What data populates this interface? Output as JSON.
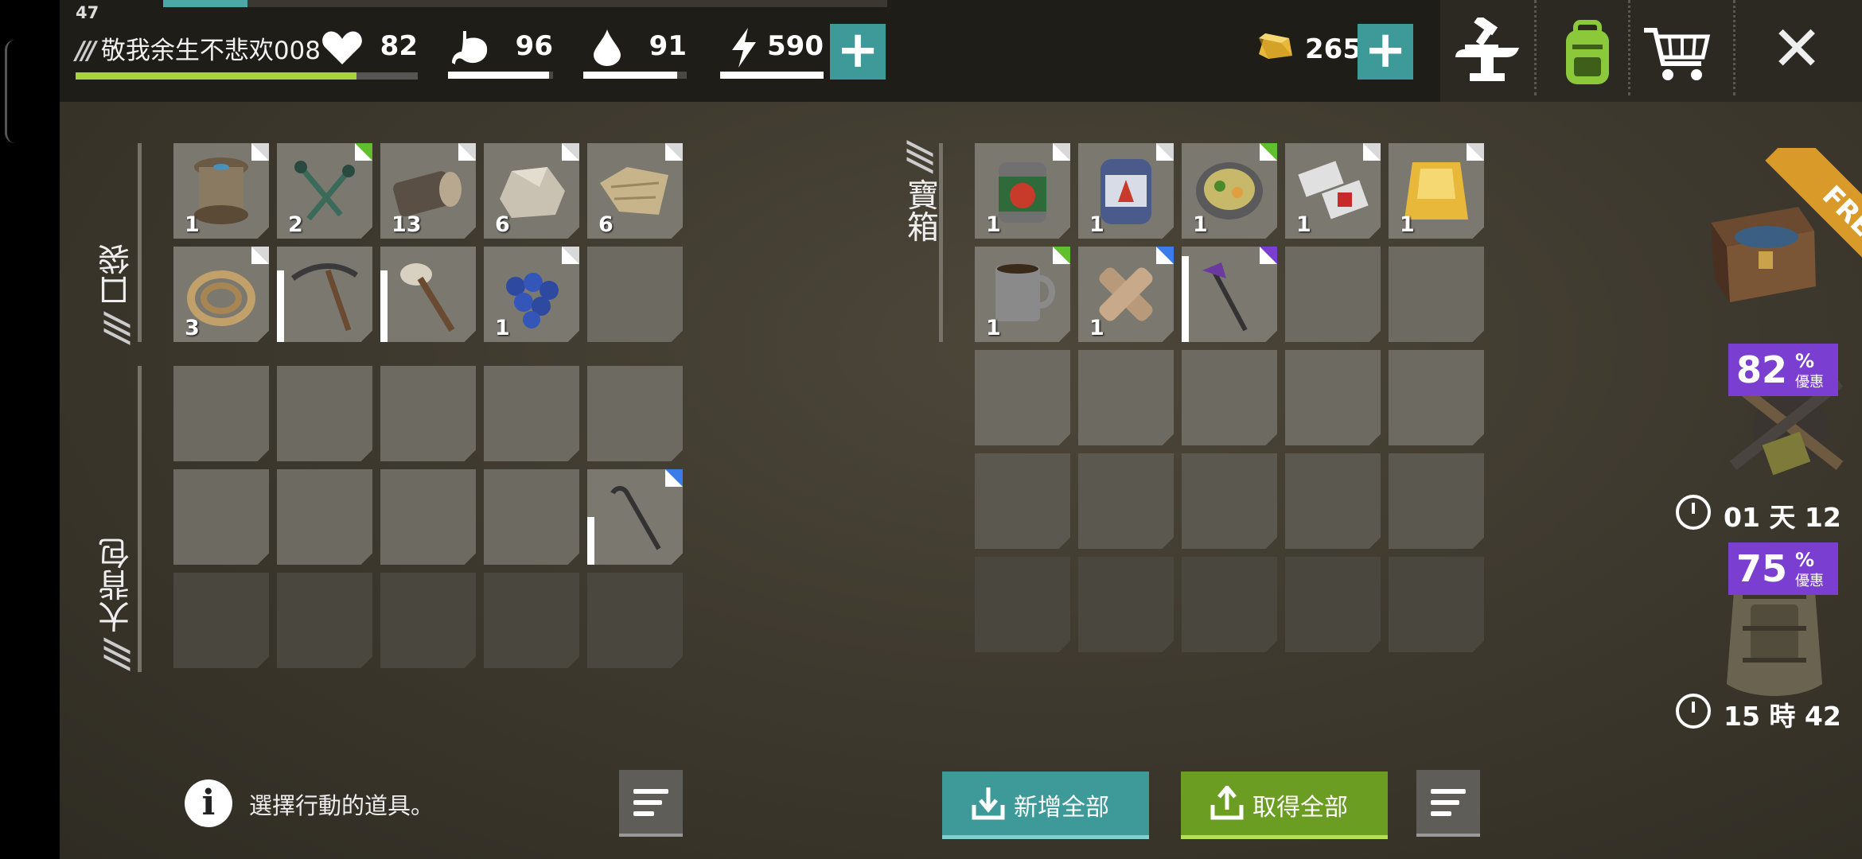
{
  "player": {
    "level": "47",
    "name": "敬我余生不悲欢008",
    "health_fill": 0.82
  },
  "stats": [
    {
      "icon": "heart-icon",
      "value": "82",
      "fill": 0.82
    },
    {
      "icon": "stomach-icon",
      "value": "96",
      "fill": 0.96
    },
    {
      "icon": "water-drop-icon",
      "value": "91",
      "fill": 0.91
    },
    {
      "icon": "energy-bolt-icon",
      "value": "590",
      "fill": 1.0
    }
  ],
  "currency": {
    "icon": "gold-bar-icon",
    "value": "265"
  },
  "top_icons": [
    "anvil-craft-icon",
    "backpack-icon",
    "shopping-cart-icon",
    "close-icon"
  ],
  "sections": {
    "pockets": "口袋",
    "backpack": "大背包",
    "chest": "寶箱"
  },
  "pocket_items": [
    {
      "icon": "thread-spool-icon",
      "count": "1",
      "corner": "#d8d8d8"
    },
    {
      "icon": "nails-icon",
      "count": "2",
      "corner": "#5fbf2f"
    },
    {
      "icon": "log-icon",
      "count": "13",
      "corner": "#d8d8d8"
    },
    {
      "icon": "stone-icon",
      "count": "6",
      "corner": "#d8d8d8"
    },
    {
      "icon": "cloth-icon",
      "count": "6",
      "corner": "#d8d8d8"
    },
    {
      "icon": "rope-icon",
      "count": "3",
      "corner": "#d8d8d8"
    },
    {
      "icon": "pickaxe-icon",
      "count": "",
      "durability": 0.75
    },
    {
      "icon": "stone-club-icon",
      "count": "",
      "durability": 0.75
    },
    {
      "icon": "blueberries-icon",
      "count": "1",
      "corner": "#d8d8d8"
    },
    {
      "icon": "",
      "count": ""
    }
  ],
  "backpack_items": [
    {
      "icon": "crowbar-icon",
      "count": "",
      "corner": "#3b7bea",
      "durability": 0.5
    }
  ],
  "chest_items": [
    {
      "icon": "canned-tomato-icon",
      "count": "1",
      "corner": "#d8d8d8"
    },
    {
      "icon": "water-container-icon",
      "count": "1",
      "corner": "#d8d8d8"
    },
    {
      "icon": "stew-bowl-icon",
      "count": "1",
      "corner": "#5fbf2f"
    },
    {
      "icon": "bandage-roll-icon",
      "count": "1",
      "corner": "#d8d8d8"
    },
    {
      "icon": "gold-bar-icon",
      "count": "1",
      "corner": "#d8d8d8"
    },
    {
      "icon": "coffee-mug-icon",
      "count": "1",
      "corner": "#5fbf2f"
    },
    {
      "icon": "plaster-bandage-icon",
      "count": "1",
      "corner": "#3b7bea"
    },
    {
      "icon": "purple-weapon-icon",
      "count": "",
      "corner": "#7a3fd0",
      "durability": 0.9
    }
  ],
  "footer": {
    "hint": "選擇行動的道具。",
    "add_all": "新增全部",
    "take_all": "取得全部"
  },
  "offers": [
    {
      "tag": "FREE"
    },
    {
      "percent": "82",
      "pct_sign": "%",
      "label": "優惠",
      "timer": "01 天 12"
    },
    {
      "percent": "75",
      "pct_sign": "%",
      "label": "優惠",
      "timer": "15 時 42"
    }
  ],
  "colors": {
    "teal": "#3e9a98",
    "green": "#6a9d22",
    "purple": "#7a3fd0",
    "health": "#a7d43a"
  }
}
